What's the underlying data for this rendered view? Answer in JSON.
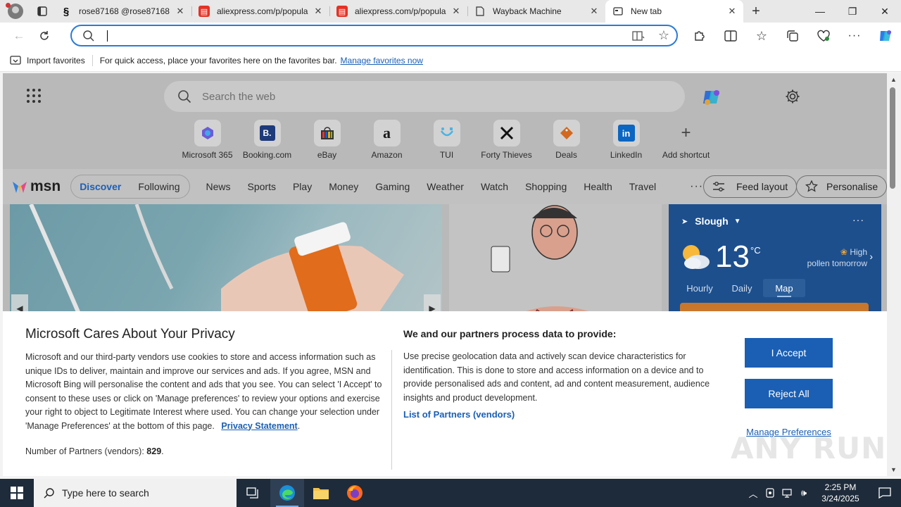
{
  "browser": {
    "tabs": [
      {
        "title": "rose87168 @rose87168 - ",
        "favicon": "threads-icon",
        "active": false
      },
      {
        "title": "aliexpress.com/p/popula",
        "favicon": "aliexpress-icon",
        "active": false
      },
      {
        "title": "aliexpress.com/p/popula",
        "favicon": "aliexpress-icon",
        "active": false
      },
      {
        "title": "Wayback Machine",
        "favicon": "document-icon",
        "active": false
      },
      {
        "title": "New tab",
        "favicon": "newtab-icon",
        "active": true
      }
    ],
    "address": {
      "value": "",
      "placeholder": ""
    },
    "favorites_bar": {
      "import_label": "Import favorites",
      "message": "For quick access, place your favorites here on the favorites bar.",
      "manage_link": "Manage favorites now"
    }
  },
  "msn": {
    "search_placeholder": "Search the web",
    "shortcuts": [
      {
        "label": "Microsoft 365",
        "icon": "m365-icon"
      },
      {
        "label": "Booking.com",
        "icon": "booking-icon"
      },
      {
        "label": "eBay",
        "icon": "ebay-icon"
      },
      {
        "label": "Amazon",
        "icon": "amazon-icon"
      },
      {
        "label": "TUI",
        "icon": "tui-icon"
      },
      {
        "label": "Forty Thieves",
        "icon": "forty-thieves-icon"
      },
      {
        "label": "Deals",
        "icon": "deals-icon"
      },
      {
        "label": "LinkedIn",
        "icon": "linkedin-icon"
      },
      {
        "label": "Add shortcut",
        "icon": "plus-icon"
      }
    ],
    "logo_text": "msn",
    "feed_tabs": [
      "Discover",
      "Following"
    ],
    "nav": [
      "News",
      "Sports",
      "Play",
      "Money",
      "Gaming",
      "Weather",
      "Watch",
      "Shopping",
      "Health",
      "Travel"
    ],
    "more": "···",
    "feed_layout": "Feed layout",
    "personalise": "Personalise",
    "weather": {
      "location": "Slough",
      "temp": "13",
      "unit": "°C",
      "pollen_level": "High",
      "pollen_text": "pollen tomorrow",
      "tabs": [
        "Hourly",
        "Daily",
        "Map"
      ],
      "active_tab": "Map",
      "more": "···"
    }
  },
  "privacy": {
    "title": "Microsoft Cares About Your Privacy",
    "body": "Microsoft and our third-party vendors use cookies to store and access information such as unique IDs to deliver, maintain and improve our services and ads. If you agree, MSN and Microsoft Bing will personalise the content and ads that you see. You can select 'I Accept' to consent to these uses or click on 'Manage preferences' to review your options and exercise your right to object to Legitimate Interest where used.  You can change your selection under 'Manage Preferences' at the bottom of this page.",
    "statement_link": "Privacy Statement",
    "partners_label": "Number of Partners (vendors):",
    "partners_count": "829",
    "process_heading": "We and our partners process data to provide:",
    "process_body": "Use precise geolocation data and actively scan device characteristics for identification. This is done to store and access information on a device and to provide personalised ads and content, ad and content measurement, audience insights and product development.",
    "partners_list_link": "List of Partners (vendors)",
    "accept": "I Accept",
    "reject": "Reject All",
    "manage": "Manage Preferences",
    "watermark": "ANY RUN"
  },
  "taskbar": {
    "search_placeholder": "Type here to search",
    "time": "2:25 PM",
    "date": "3/24/2025"
  },
  "colors": {
    "accent": "#1a5fb4",
    "weather_card": "#1d4f8d",
    "taskbar": "#1e2b3a"
  }
}
